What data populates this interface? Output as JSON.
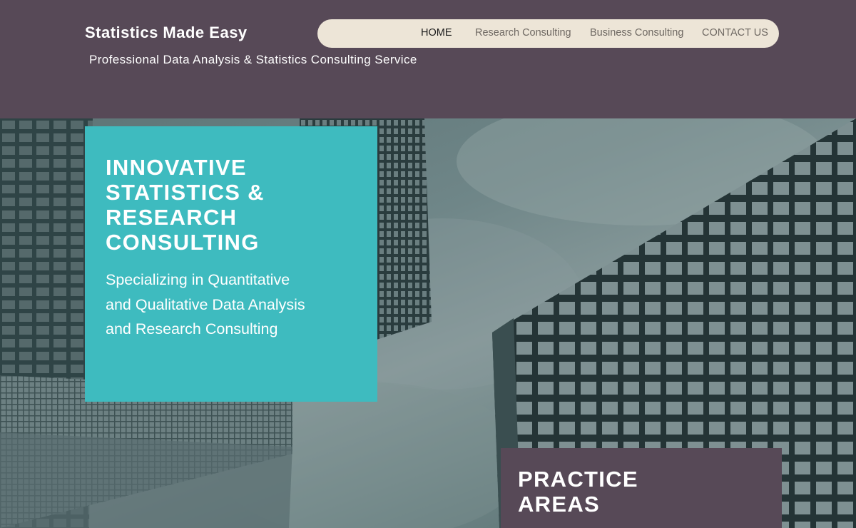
{
  "header": {
    "site_title": "Statistics Made Easy",
    "tagline": "Professional Data Analysis & Statistics Consulting Service"
  },
  "nav": {
    "items": [
      {
        "label": "HOME",
        "active": true
      },
      {
        "label": "Research Consulting",
        "active": false
      },
      {
        "label": "Business Consulting",
        "active": false
      },
      {
        "label": "CONTACT US",
        "active": false
      }
    ]
  },
  "hero": {
    "title": "INNOVATIVE STATISTICS & RESEARCH CONSULTING",
    "subtitle": "Specializing in Quantitative and Qualitative Data Analysis and Research Consulting"
  },
  "practice": {
    "title": "PRACTICE AREAS"
  },
  "colors": {
    "header_bg": "#574957",
    "nav_bg": "#ede5d7",
    "accent_teal": "#3ebbbf",
    "text_white": "#ffffff"
  }
}
